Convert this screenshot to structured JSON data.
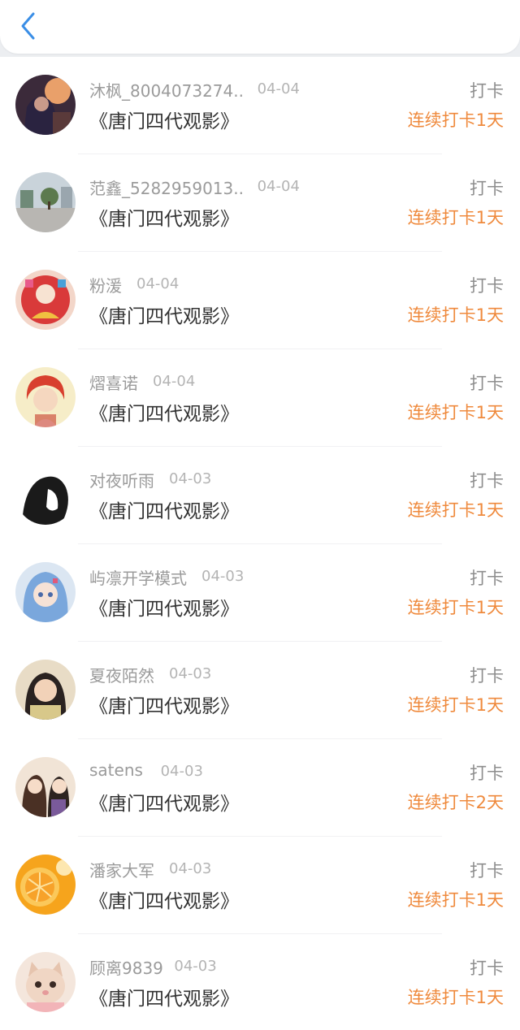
{
  "header": {
    "back_icon": "chevron-left-icon",
    "accent_color": "#3a8ee6"
  },
  "colors": {
    "streak": "#ef8a3d",
    "name": "#9b9b9b",
    "title": "#333333"
  },
  "entries": [
    {
      "name": "沐枫_8004073274...",
      "date": "04-04",
      "title": "《唐门四代观影》",
      "action": "打卡",
      "streak": "连续打卡1天",
      "avatar": "avatar-anime-dark"
    },
    {
      "name": "范鑫_5282959013...",
      "date": "04-04",
      "title": "《唐门四代观影》",
      "action": "打卡",
      "streak": "连续打卡1天",
      "avatar": "avatar-street-photo"
    },
    {
      "name": "粉湲",
      "date": "04-04",
      "title": "《唐门四代观影》",
      "action": "打卡",
      "streak": "连续打卡1天",
      "avatar": "avatar-red-festive"
    },
    {
      "name": "熠喜诺",
      "date": "04-04",
      "title": "《唐门四代观影》",
      "action": "打卡",
      "streak": "连续打卡1天",
      "avatar": "avatar-red-hair-anime"
    },
    {
      "name": "对夜听雨",
      "date": "04-03",
      "title": "《唐门四代观影》",
      "action": "打卡",
      "streak": "连续打卡1天",
      "avatar": "avatar-silhouette"
    },
    {
      "name": "屿凛开学模式",
      "date": "04-03",
      "title": "《唐门四代观影》",
      "action": "打卡",
      "streak": "连续打卡1天",
      "avatar": "avatar-blue-hair-anime"
    },
    {
      "name": "夏夜陌然",
      "date": "04-03",
      "title": "《唐门四代观影》",
      "action": "打卡",
      "streak": "连续打卡1天",
      "avatar": "avatar-girl-photo"
    },
    {
      "name": "satens",
      "date": "04-03",
      "title": "《唐门四代观影》",
      "action": "打卡",
      "streak": "连续打卡2天",
      "avatar": "avatar-anime-couple"
    },
    {
      "name": "潘家大军",
      "date": "04-03",
      "title": "《唐门四代观影》",
      "action": "打卡",
      "streak": "连续打卡1天",
      "avatar": "avatar-orange"
    },
    {
      "name": "顾离9839",
      "date": "04-03",
      "title": "《唐门四代观影》",
      "action": "打卡",
      "streak": "连续打卡1天",
      "avatar": "avatar-cat"
    }
  ]
}
